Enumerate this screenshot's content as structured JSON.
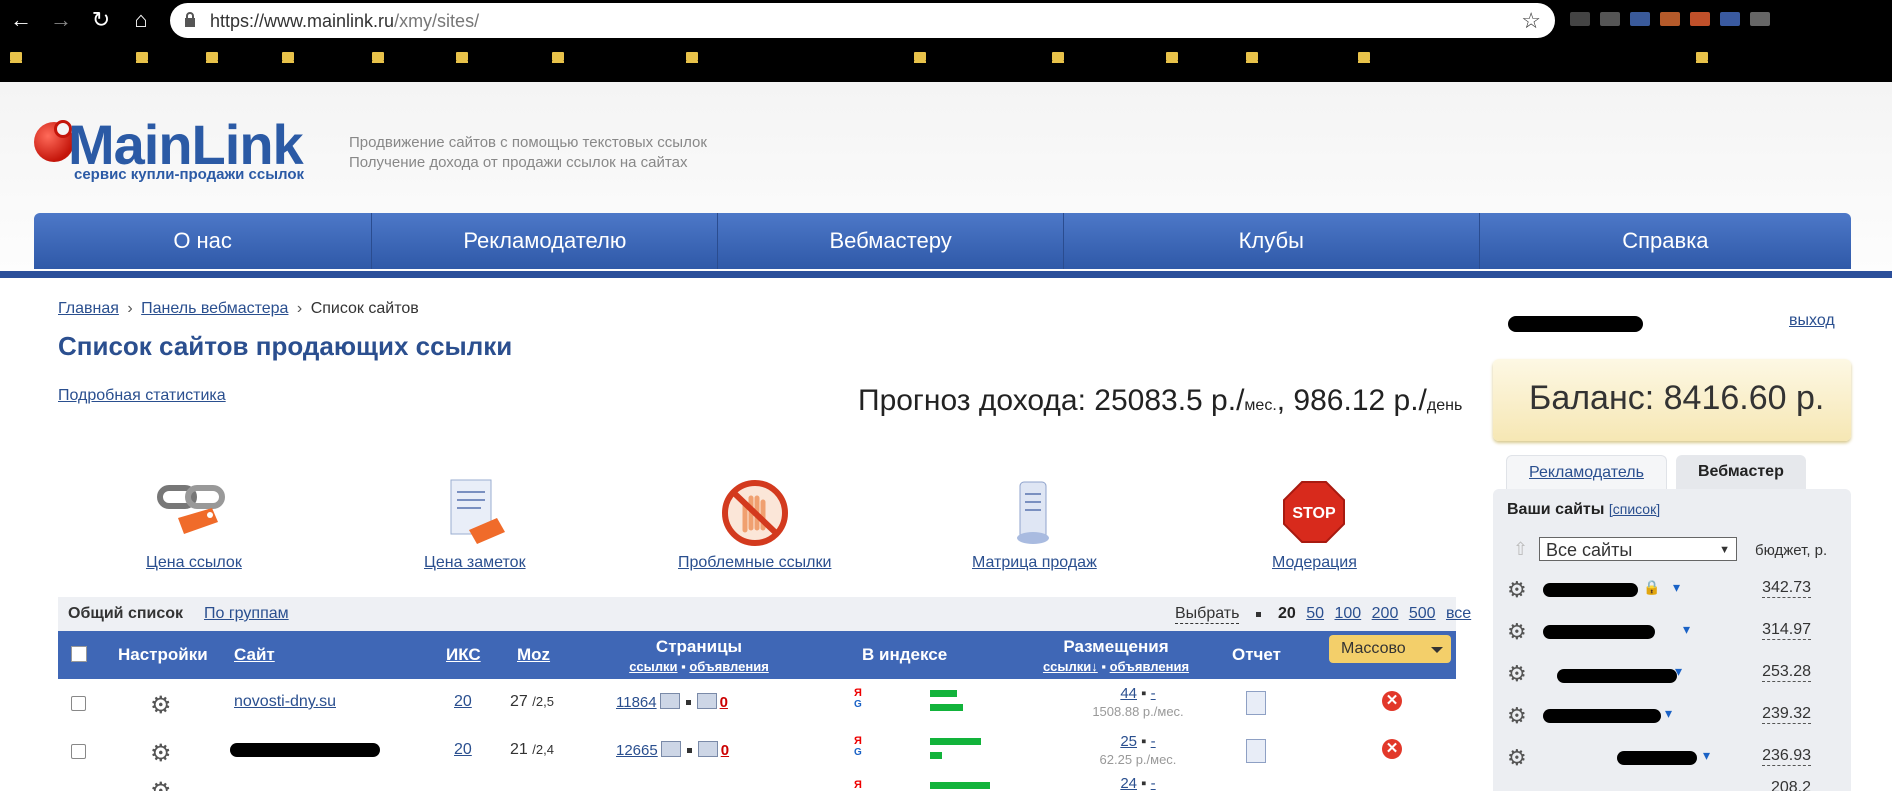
{
  "browser": {
    "url_host": "https://www.mainlink.ru",
    "url_path": "/xmy/sites/",
    "back_glyph": "←",
    "forward_glyph": "→",
    "reload_glyph": "↻",
    "home_glyph": "⌂",
    "star_glyph": "☆"
  },
  "header": {
    "logo_name": "MainLink",
    "logo_sub": "сервис купли-продажи ссылок",
    "tagline1": "Продвижение сайтов с помощью текстовых ссылок",
    "tagline2": "Получение дохода от продажи ссылок на сайтах",
    "nav": [
      "О нас",
      "Рекламодателю",
      "Вебмастеру",
      "Клубы",
      "Справка"
    ]
  },
  "breadcrumb": {
    "home": "Главная",
    "sep": "›",
    "panel": "Панель вебмастера",
    "current": "Список сайтов"
  },
  "page": {
    "title": "Список сайтов продающих ссылки",
    "stat_link": "Подробная статистика",
    "forecast_label": "Прогноз дохода: 25083.5 р./",
    "forecast_unit1": "мес.",
    "forecast_mid": ", 986.12 р./",
    "forecast_unit2": "день"
  },
  "tools": [
    {
      "label": "Цена ссылок",
      "icon": "chain-price-icon"
    },
    {
      "label": "Цена заметок",
      "icon": "notes-price-icon"
    },
    {
      "label": "Проблемные ссылки",
      "icon": "forbidden-hand-icon"
    },
    {
      "label": "Матрица продаж",
      "icon": "scroll-icon"
    },
    {
      "label": "Модерация",
      "icon": "stop-sign-icon",
      "sign_text": "STOP"
    }
  ],
  "listbar": {
    "all": "Общий список",
    "groups": "По группам",
    "select": "Выбрать",
    "per_page": [
      "20",
      "50",
      "100",
      "200",
      "500",
      "все"
    ]
  },
  "table": {
    "headers": {
      "settings": "Настройки",
      "site": "Сайт",
      "iks": "ИКС",
      "moz": "Moz",
      "pages": "Страницы",
      "pages_links": "ссылки",
      "pages_ads": "объявления",
      "index": "В индексе",
      "placements": "Размещения",
      "placements_links": "ссылки↓",
      "placements_ads": "объявления",
      "report": "Отчет",
      "mass": "Массово"
    },
    "rows": [
      {
        "site": "novosti-dny.su",
        "iks": "20",
        "moz": "27",
        "moz_sub": "/2,5",
        "pages_links": "11864",
        "pages_ads": "0",
        "ya": 0.45,
        "google": 0.55,
        "links": "44",
        "ads": "-",
        "income": "1508.88 р./мес."
      },
      {
        "site": "",
        "iks": "20",
        "moz": "21",
        "moz_sub": "/2,4",
        "pages_links": "12665",
        "pages_ads": "0",
        "ya": 0.85,
        "google": 0.2,
        "links": "25",
        "ads": "-",
        "income": "62.25 р./мес."
      },
      {
        "site": "",
        "iks": "",
        "moz": "",
        "moz_sub": "",
        "pages_links": "",
        "pages_ads": "",
        "ya": 1.0,
        "google": 0,
        "links": "24",
        "ads": "-",
        "income": ""
      }
    ]
  },
  "sidebar": {
    "logout": "выход",
    "balance": "Баланс: 8416.60 р.",
    "tab_advertiser": "Рекламодатель",
    "tab_webmaster": "Вебмастер",
    "your_sites": "Ваши сайты",
    "list_link": "[список]",
    "filter_value": "Все сайты",
    "budget_label": "бюджет, р.",
    "sites": [
      {
        "budget": "342.73"
      },
      {
        "budget": "314.97"
      },
      {
        "budget": "253.28"
      },
      {
        "budget": "239.32"
      },
      {
        "budget": "236.93"
      },
      {
        "budget": "208.2"
      }
    ]
  },
  "colors": {
    "brand_blue": "#2b5aa5",
    "nav_blue": "#3f67b6",
    "balance_bg": "#f6e7b4",
    "index_green": "#12b33b",
    "delete_red": "#e2382a"
  }
}
